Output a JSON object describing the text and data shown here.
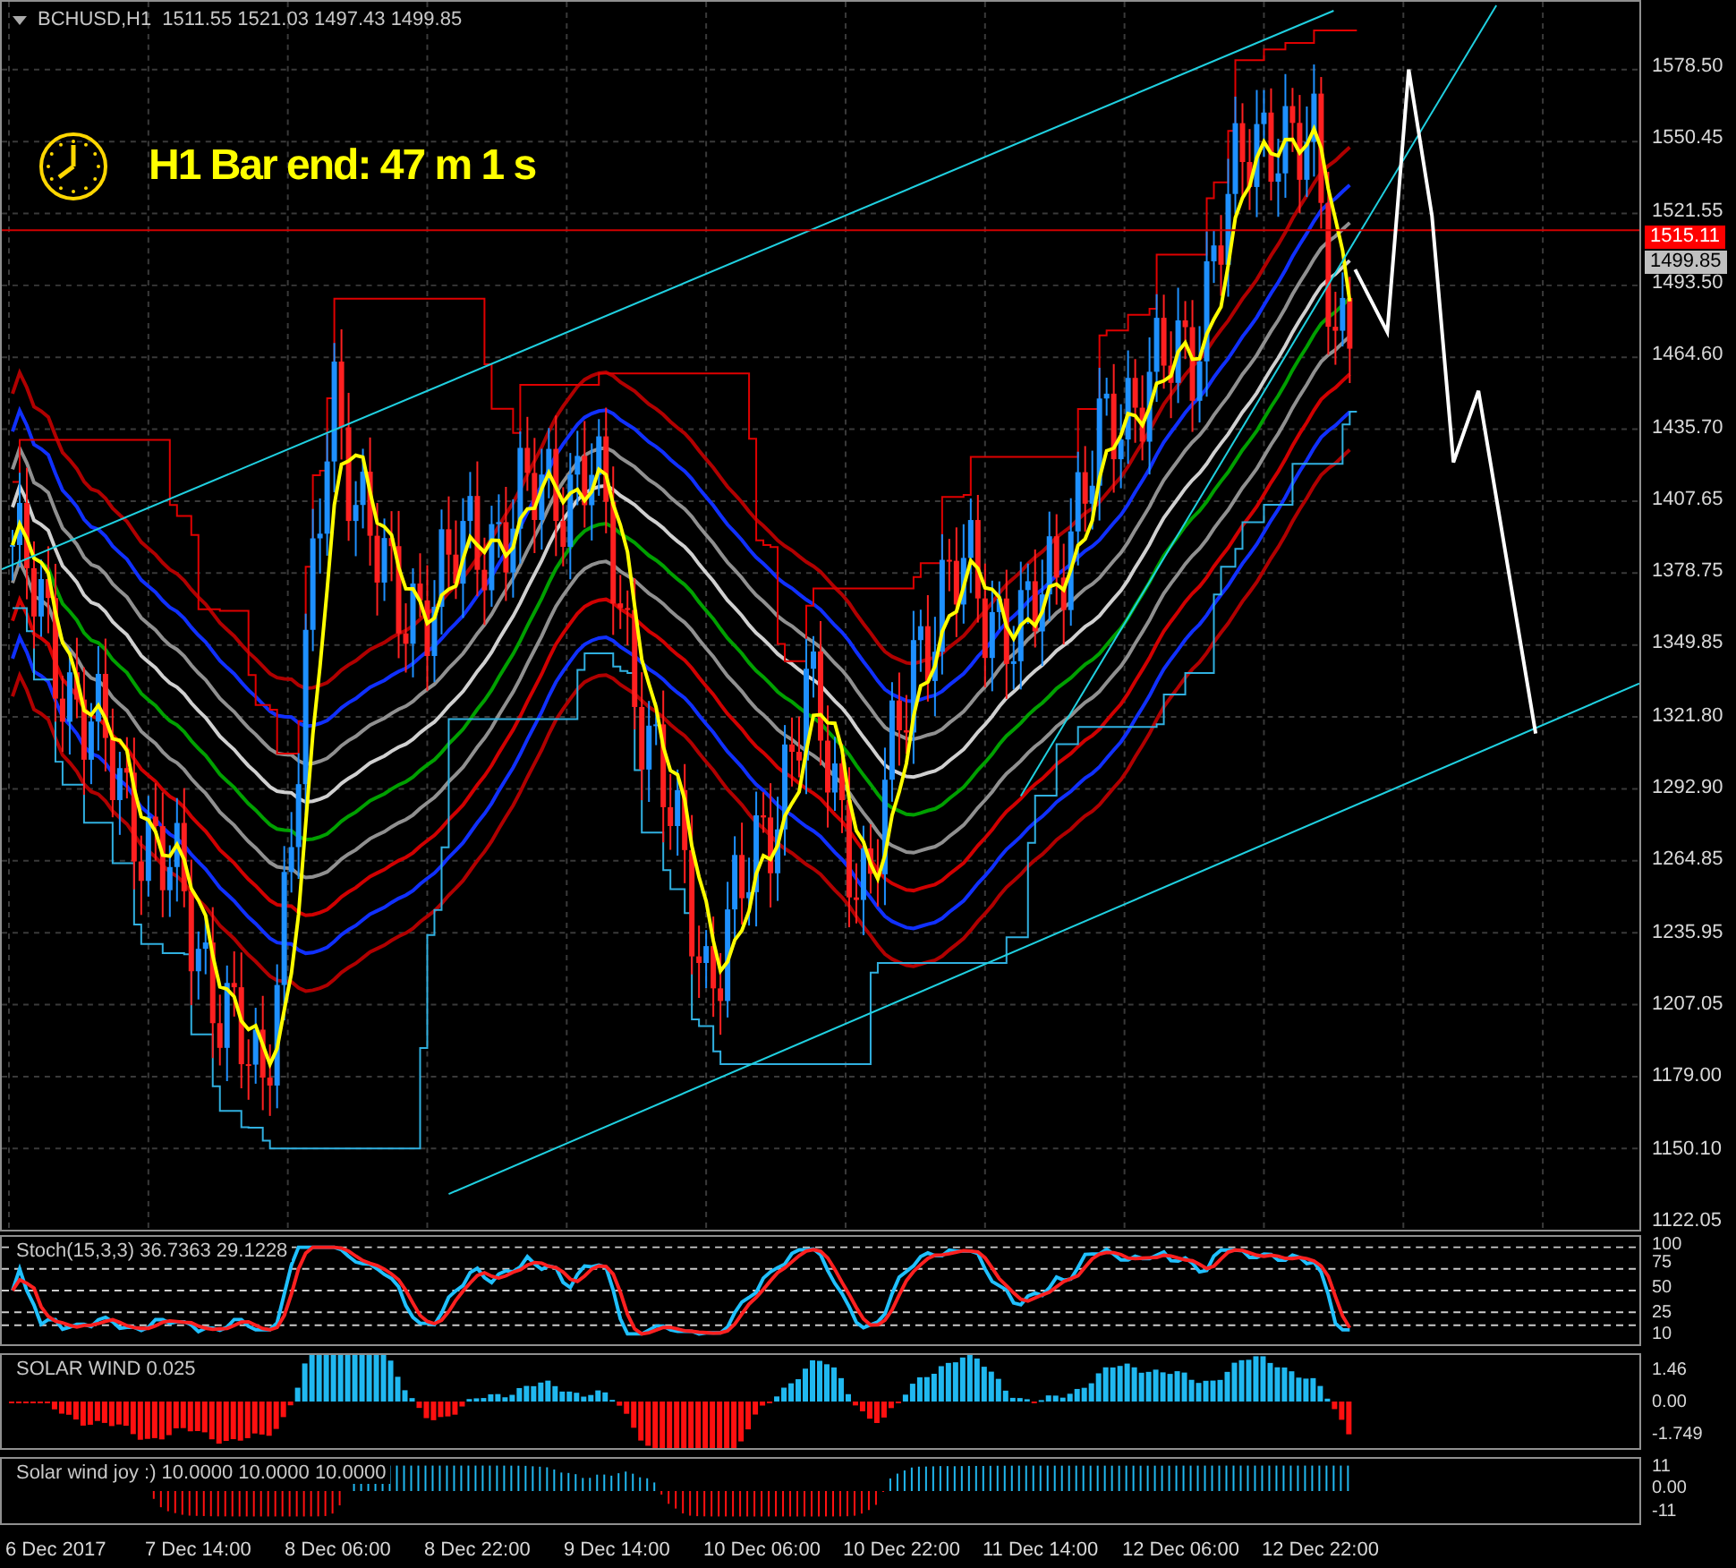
{
  "chart": {
    "symbol_line": "BCHUSD,H1  1511.55 1521.03 1497.43 1499.85",
    "timer": "H1 Bar end: 47 m 1 s",
    "price_axis": [
      "1578.50",
      "1550.45",
      "1521.55",
      "1493.50",
      "1464.60",
      "1435.70",
      "1407.65",
      "1378.75",
      "1349.85",
      "1321.80",
      "1292.90",
      "1264.85",
      "1235.95",
      "1207.05",
      "1179.00",
      "1150.10",
      "1122.05"
    ],
    "price_tags": [
      {
        "text": "1515.11",
        "kind": "bid"
      },
      {
        "text": "1499.85",
        "kind": "last"
      }
    ]
  },
  "indicators": [
    {
      "kind": "stochastic",
      "label": "Stoch(15,3,3) 36.7363 29.1228",
      "scale": [
        "100",
        "75",
        "50",
        "25",
        "10"
      ]
    },
    {
      "kind": "solar_wind",
      "label": "SOLAR WIND 0.025",
      "scale": [
        "1.46",
        "0.00",
        "-1.749"
      ]
    },
    {
      "kind": "solar_joy",
      "label": "Solar wind joy :) 10.0000 10.0000 10.0000",
      "scale": [
        "11",
        "0.00",
        "-11"
      ]
    }
  ],
  "time_axis": [
    "6 Dec 2017",
    "7 Dec 14:00",
    "8 Dec 06:00",
    "8 Dec 22:00",
    "9 Dec 14:00",
    "10 Dec 06:00",
    "10 Dec 22:00",
    "11 Dec 14:00",
    "12 Dec 06:00",
    "12 Dec 22:00"
  ]
}
